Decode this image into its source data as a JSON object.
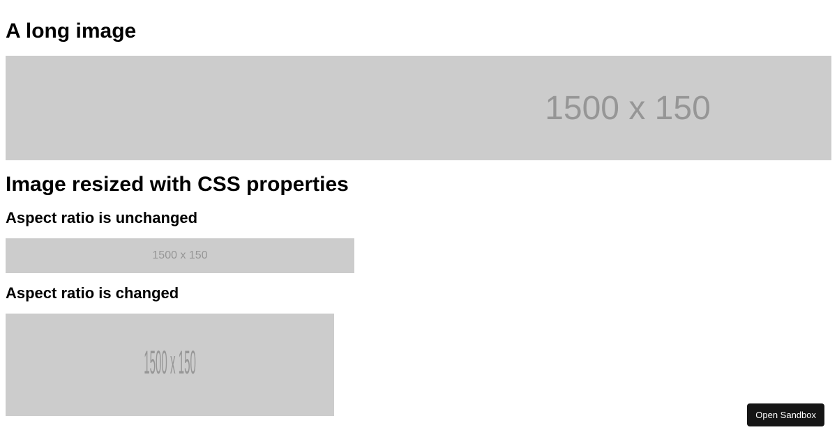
{
  "headings": {
    "h2_1": "A long image",
    "h2_2": "Image resized with CSS properties",
    "h3_1": "Aspect ratio is unchanged",
    "h3_2": "Aspect ratio is changed"
  },
  "placeholders": {
    "large": "1500 x 150",
    "small": "1500 x 150",
    "stretched": "1500 x 150"
  },
  "sandbox_button": "Open Sandbox"
}
